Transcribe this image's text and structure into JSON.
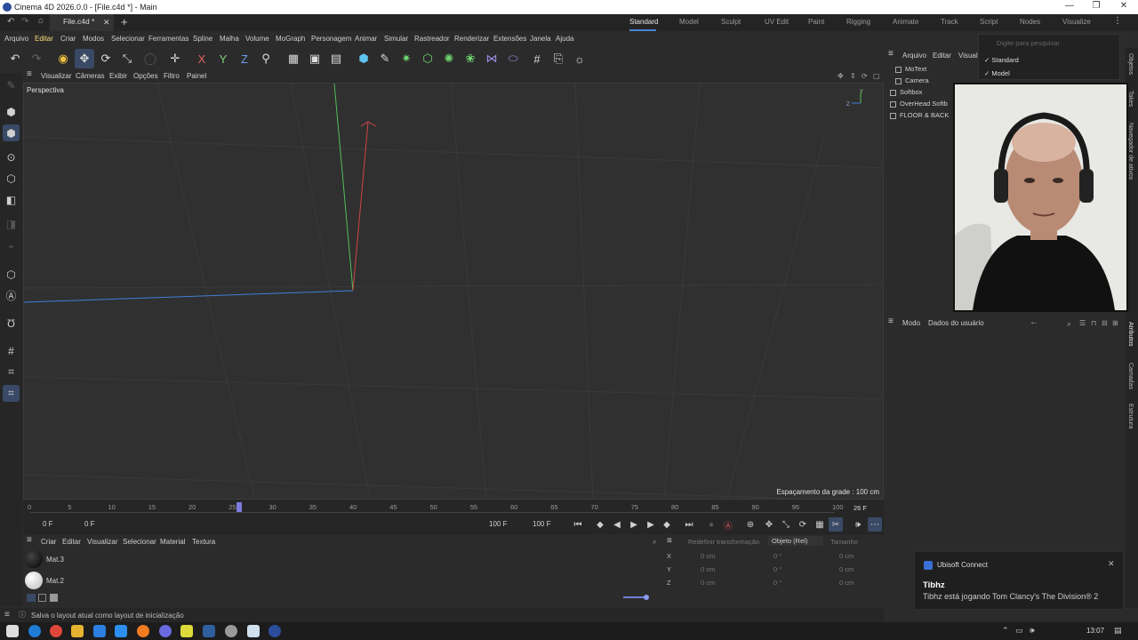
{
  "window": {
    "title": "Cinema 4D 2026.0.0 - [File.c4d *] - Main"
  },
  "tabs": {
    "doc_tab": "File.c4d *",
    "add": "+",
    "close": "✕"
  },
  "layouts": [
    "Standard",
    "Model",
    "Sculpt",
    "UV Edit",
    "Paint",
    "Rigging",
    "Animate",
    "Track",
    "Script",
    "Nodes",
    "Visualize"
  ],
  "menu": [
    "Arquivo",
    "Editar",
    "Criar",
    "Modos",
    "Selecionar",
    "Ferramentas",
    "Spline",
    "Malha",
    "Volume",
    "MoGraph",
    "Personagem",
    "Animar",
    "Simular",
    "Rastreador",
    "Renderizar",
    "Extensões",
    "Janela",
    "Ajuda"
  ],
  "viewport": {
    "menu": [
      "Visualizar",
      "Câmeras",
      "Exibir",
      "Opções",
      "Filtro",
      "Painel"
    ],
    "label": "Perspectiva",
    "grid_spacing": "Espaçamento da grade : 100 cm"
  },
  "timeline": {
    "ticks": [
      "0",
      "5",
      "10",
      "15",
      "20",
      "25",
      "30",
      "35",
      "40",
      "45",
      "50",
      "55",
      "60",
      "65",
      "70",
      "75",
      "80",
      "85",
      "90",
      "95",
      "100"
    ],
    "current_frame": "26 F",
    "playhead_marker": "26",
    "start_field": "0 F",
    "start_field2": "0 F",
    "end_field": "100 F",
    "end_field2": "100 F",
    "playhead_fraction": 0.26
  },
  "materials": {
    "menu": [
      "Criar",
      "Editar",
      "Visualizar",
      "Selecionar",
      "Material",
      "Textura"
    ],
    "items": [
      {
        "name": "Mat.3",
        "color": "#050505"
      },
      {
        "name": "Mat.2",
        "color": "#b9b9b9"
      }
    ]
  },
  "coords": {
    "header": [
      "Redefinir transformação",
      "Objeto (Rel)",
      "Tamanho"
    ],
    "rows": [
      {
        "axis": "X",
        "pos": "0 cm",
        "rot": "0 °",
        "size": "0 cm"
      },
      {
        "axis": "Y",
        "pos": "0 cm",
        "rot": "0 °",
        "size": "0 cm"
      },
      {
        "axis": "Z",
        "pos": "0 cm",
        "rot": "0 °",
        "size": "0 cm"
      }
    ]
  },
  "status": {
    "text": "Salva o layout atual como layout de inicialização"
  },
  "objects": {
    "menu": [
      "Arquivo",
      "Editar",
      "Visual"
    ],
    "items": [
      "MoText",
      "Camera",
      "Softbox",
      "OverHead Softb",
      "FLOOR & BACK"
    ]
  },
  "attributes": {
    "menu": [
      "Modo",
      "Dados do usuário"
    ]
  },
  "side_tabs": [
    "Objetos",
    "Takes",
    "Navegador de ativos",
    "Atributos",
    "Camadas",
    "Estrutura"
  ],
  "layout_dropdown": {
    "placeholder": "Digite para pesquisar",
    "options": [
      "Standard",
      "Model"
    ]
  },
  "toast": {
    "app": "Ubisoft Connect",
    "title": "Tibhz",
    "body": "Tibhz está jogando Tom Clancy's The Division® 2"
  },
  "taskbar": {
    "time": "13:07"
  },
  "colors": {
    "accent": "#3a4a66",
    "axis_x": "#d04545",
    "axis_y": "#4fbf5a",
    "axis_z": "#3f7fd6",
    "background": "#2b2b2b"
  }
}
